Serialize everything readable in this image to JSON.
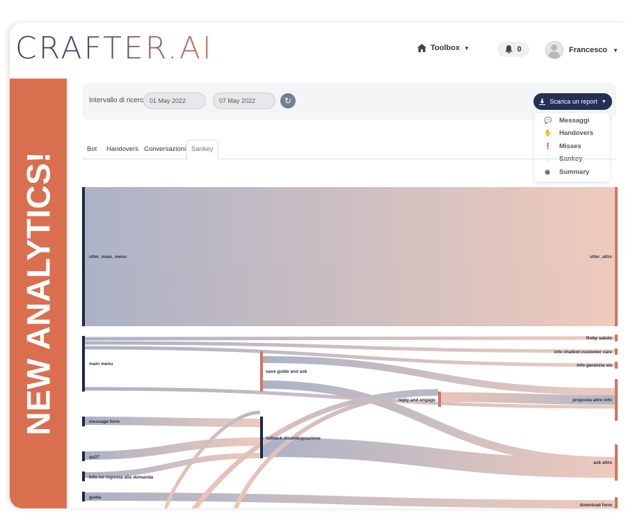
{
  "header": {
    "logo_text": "CRAFTER.AI",
    "toolbox_label": "Toolbox",
    "notifications_count": "0",
    "user_name": "Francesco"
  },
  "banner": {
    "text": "NEW ANALYTICS!"
  },
  "filters": {
    "label": "Intervallo di ricerca:",
    "date_from": "01 May 2022",
    "date_to": "07 May 2022",
    "report_button": "Scarica un report"
  },
  "report_menu": {
    "items": [
      {
        "label": "Messaggi",
        "icon": "chat-bubbles-icon"
      },
      {
        "label": "Handovers",
        "icon": "hand-icon"
      },
      {
        "label": "Misses",
        "icon": "exclamation-circle-icon"
      },
      {
        "label": "Sankey",
        "icon": "speech-bubble-outline-icon"
      },
      {
        "label": "Summary",
        "icon": "dot-circle-icon"
      }
    ]
  },
  "tabs": [
    {
      "label": "Bot"
    },
    {
      "label": "Handovers"
    },
    {
      "label": "Conversazioni"
    },
    {
      "label": "Sankey",
      "active": true
    }
  ],
  "sankey": {
    "nodes": [
      {
        "label": "utter_main_menu"
      },
      {
        "label": "main menu"
      },
      {
        "label": "message form"
      },
      {
        "label": "qa37"
      },
      {
        "label": "info no risposta alla domanda"
      },
      {
        "label": "guida"
      },
      {
        "label": "save guide and ask"
      },
      {
        "label": "fallback disambiguazione"
      },
      {
        "label": "reply and engage"
      },
      {
        "label": "utter_altro"
      },
      {
        "label": "Roby saluto"
      },
      {
        "label": "info chatbot customer care"
      },
      {
        "label": "info garanzia sla"
      },
      {
        "label": "proposta altre info"
      },
      {
        "label": "ask altro"
      },
      {
        "label": "download form"
      }
    ]
  },
  "colors": {
    "accent_orange": "#d96f4e",
    "navy": "#252f57",
    "node_dark": "#1f2647",
    "node_orange": "#d0765c"
  }
}
